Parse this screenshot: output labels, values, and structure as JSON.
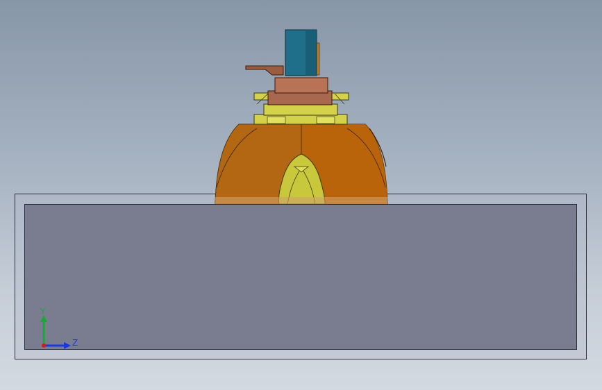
{
  "viewport": {
    "background_top": "#8796a8",
    "background_bottom": "#d3d9e1"
  },
  "model": {
    "colors": {
      "motor": "#1f6f8b",
      "bracket": "#a8674f",
      "plate": "#d4d24a",
      "dome_left": "#c77a1a",
      "dome_right": "#b8620a",
      "spout": "#c9c83c",
      "tank_fill": "#7a7d8f"
    }
  },
  "triad": {
    "y_label": "Y",
    "z_label": "Z",
    "y_color": "#1aa83a",
    "z_color": "#1a3ad8",
    "x_color": "#d81a1a"
  }
}
